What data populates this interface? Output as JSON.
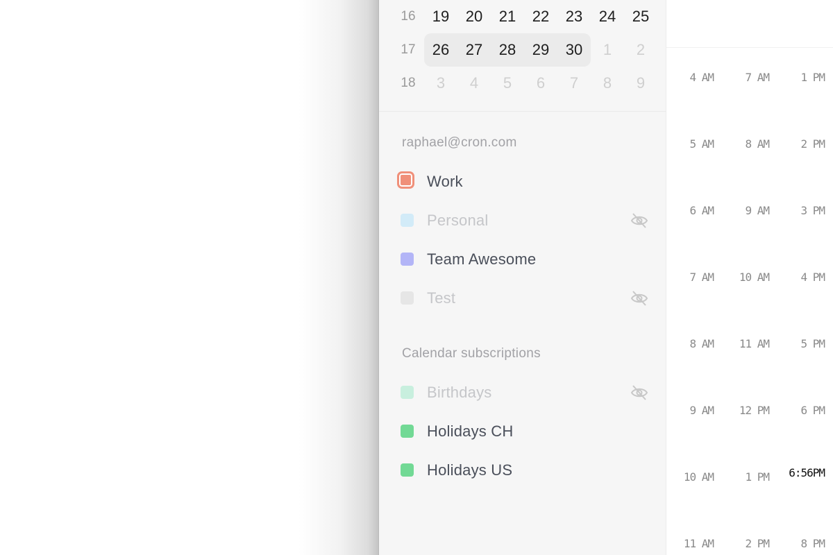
{
  "mini_calendar": {
    "weeks": [
      {
        "week": "16",
        "days": [
          {
            "d": "19",
            "muted": false
          },
          {
            "d": "20",
            "muted": false
          },
          {
            "d": "21",
            "muted": false
          },
          {
            "d": "22",
            "muted": false
          },
          {
            "d": "23",
            "muted": false
          },
          {
            "d": "24",
            "muted": false
          },
          {
            "d": "25",
            "muted": false
          }
        ]
      },
      {
        "week": "17",
        "days": [
          {
            "d": "26",
            "muted": false
          },
          {
            "d": "27",
            "muted": false
          },
          {
            "d": "28",
            "muted": false
          },
          {
            "d": "29",
            "muted": false
          },
          {
            "d": "30",
            "muted": false
          },
          {
            "d": "1",
            "muted": true
          },
          {
            "d": "2",
            "muted": true
          }
        ]
      },
      {
        "week": "18",
        "days": [
          {
            "d": "3",
            "muted": true
          },
          {
            "d": "4",
            "muted": true
          },
          {
            "d": "5",
            "muted": true
          },
          {
            "d": "6",
            "muted": true
          },
          {
            "d": "7",
            "muted": true
          },
          {
            "d": "8",
            "muted": true
          },
          {
            "d": "9",
            "muted": true
          }
        ]
      }
    ]
  },
  "account": {
    "email": "raphael@cron.com",
    "calendars": [
      {
        "name": "Work",
        "color": "#f0907a",
        "hidden": false,
        "selected": true
      },
      {
        "name": "Personal",
        "color": "#d2ebf8",
        "hidden": true,
        "selected": false
      },
      {
        "name": "Team Awesome",
        "color": "#b3b5f7",
        "hidden": false,
        "selected": false
      },
      {
        "name": "Test",
        "color": "#e6e6e6",
        "hidden": true,
        "selected": false
      }
    ]
  },
  "subscriptions": {
    "title": "Calendar subscriptions",
    "calendars": [
      {
        "name": "Birthdays",
        "color": "#c8efde",
        "hidden": true
      },
      {
        "name": "Holidays CH",
        "color": "#72d995",
        "hidden": false
      },
      {
        "name": "Holidays US",
        "color": "#72d995",
        "hidden": false
      }
    ]
  },
  "timeline": {
    "columns": [
      [
        "4 AM",
        "5 AM",
        "6 AM",
        "7 AM",
        "8 AM",
        "9 AM",
        "10 AM",
        "11 AM"
      ],
      [
        "7 AM",
        "8 AM",
        "9 AM",
        "10 AM",
        "11 AM",
        "12 PM",
        "1 PM",
        "2 PM"
      ],
      [
        "1 PM",
        "2 PM",
        "3 PM",
        "4 PM",
        "5 PM",
        "6 PM",
        "6:56PM",
        "8 PM"
      ]
    ],
    "current_time": "6:56PM"
  }
}
